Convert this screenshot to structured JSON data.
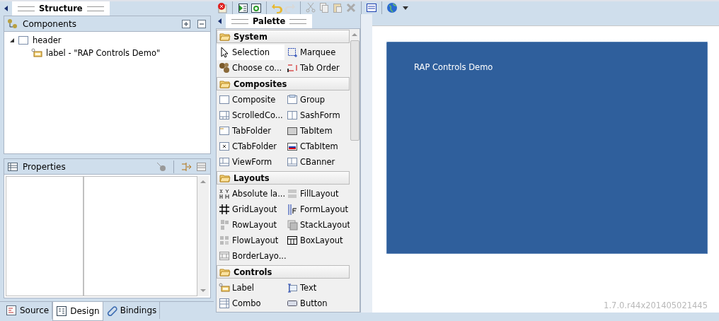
{
  "structure": {
    "title": "Structure"
  },
  "components": {
    "title": "Components",
    "tree": [
      {
        "label": "header",
        "expanded": true,
        "children": [
          {
            "label": "label - \"RAP Controls Demo\""
          }
        ]
      }
    ]
  },
  "properties": {
    "title": "Properties"
  },
  "palette": {
    "title": "Palette",
    "groups": [
      {
        "label": "System",
        "items": [
          {
            "label": "Selection",
            "selected": true
          },
          {
            "label": "Marquee",
            "selected": false
          },
          {
            "label": "Choose co...",
            "selected": false
          },
          {
            "label": "Tab Order",
            "selected": false
          }
        ]
      },
      {
        "label": "Composites",
        "items": [
          {
            "label": "Composite",
            "selected": false
          },
          {
            "label": "Group",
            "selected": false
          },
          {
            "label": "ScrolledCo...",
            "selected": false
          },
          {
            "label": "SashForm",
            "selected": false
          },
          {
            "label": "TabFolder",
            "selected": false
          },
          {
            "label": "TabItem",
            "selected": false
          },
          {
            "label": "CTabFolder",
            "selected": false
          },
          {
            "label": "CTabItem",
            "selected": false
          },
          {
            "label": "ViewForm",
            "selected": false
          },
          {
            "label": "CBanner",
            "selected": false
          }
        ]
      },
      {
        "label": "Layouts",
        "items": [
          {
            "label": "Absolute la...",
            "selected": false
          },
          {
            "label": "FillLayout",
            "selected": false
          },
          {
            "label": "GridLayout",
            "selected": false
          },
          {
            "label": "FormLayout",
            "selected": false
          },
          {
            "label": "RowLayout",
            "selected": false
          },
          {
            "label": "StackLayout",
            "selected": false
          },
          {
            "label": "FlowLayout",
            "selected": false
          },
          {
            "label": "BoxLayout",
            "selected": false
          },
          {
            "label": "BorderLayo...",
            "selected": false
          }
        ]
      },
      {
        "label": "Controls",
        "items": [
          {
            "label": "Label",
            "selected": false
          },
          {
            "label": "Text",
            "selected": false
          },
          {
            "label": "Combo",
            "selected": false
          },
          {
            "label": "Button",
            "selected": false
          }
        ]
      }
    ]
  },
  "canvas": {
    "shell_text": "RAP Controls Demo",
    "version": "1.7.0.r44x201405021445"
  },
  "bottom_tabs": [
    {
      "label": "Source",
      "selected": false
    },
    {
      "label": "Design",
      "selected": true
    },
    {
      "label": "Bindings",
      "selected": false
    }
  ]
}
